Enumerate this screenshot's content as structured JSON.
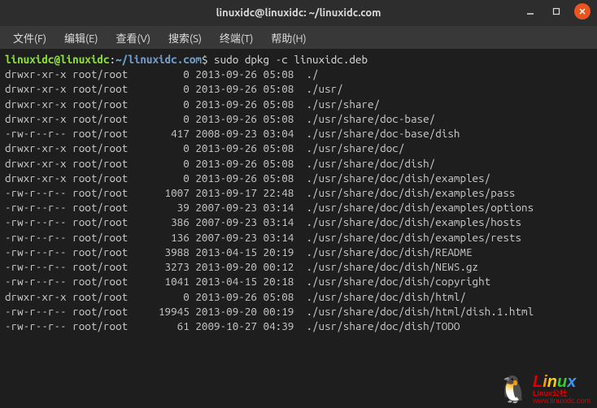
{
  "titlebar": {
    "title": "linuxidc@linuxidc: ~/linuxidc.com"
  },
  "menubar": {
    "items": [
      "文件(F)",
      "编辑(E)",
      "查看(V)",
      "搜索(S)",
      "终端(T)",
      "帮助(H)"
    ]
  },
  "prompt": {
    "user_host": "linuxidc@linuxidc",
    "colon": ":",
    "path": "~/linuxidc.com",
    "dollar": "$",
    "command": "sudo dpkg -c linuxidc.deb"
  },
  "rows": [
    {
      "perm": "drwxr-xr-x",
      "owner": "root/root",
      "size": "0",
      "date": "2013-09-26 05:08",
      "path": "./"
    },
    {
      "perm": "drwxr-xr-x",
      "owner": "root/root",
      "size": "0",
      "date": "2013-09-26 05:08",
      "path": "./usr/"
    },
    {
      "perm": "drwxr-xr-x",
      "owner": "root/root",
      "size": "0",
      "date": "2013-09-26 05:08",
      "path": "./usr/share/"
    },
    {
      "perm": "drwxr-xr-x",
      "owner": "root/root",
      "size": "0",
      "date": "2013-09-26 05:08",
      "path": "./usr/share/doc-base/"
    },
    {
      "perm": "-rw-r--r--",
      "owner": "root/root",
      "size": "417",
      "date": "2008-09-23 03:04",
      "path": "./usr/share/doc-base/dish"
    },
    {
      "perm": "drwxr-xr-x",
      "owner": "root/root",
      "size": "0",
      "date": "2013-09-26 05:08",
      "path": "./usr/share/doc/"
    },
    {
      "perm": "drwxr-xr-x",
      "owner": "root/root",
      "size": "0",
      "date": "2013-09-26 05:08",
      "path": "./usr/share/doc/dish/"
    },
    {
      "perm": "drwxr-xr-x",
      "owner": "root/root",
      "size": "0",
      "date": "2013-09-26 05:08",
      "path": "./usr/share/doc/dish/examples/"
    },
    {
      "perm": "-rw-r--r--",
      "owner": "root/root",
      "size": "1007",
      "date": "2013-09-17 22:48",
      "path": "./usr/share/doc/dish/examples/pass"
    },
    {
      "perm": "-rw-r--r--",
      "owner": "root/root",
      "size": "39",
      "date": "2007-09-23 03:14",
      "path": "./usr/share/doc/dish/examples/options"
    },
    {
      "perm": "-rw-r--r--",
      "owner": "root/root",
      "size": "386",
      "date": "2007-09-23 03:14",
      "path": "./usr/share/doc/dish/examples/hosts"
    },
    {
      "perm": "-rw-r--r--",
      "owner": "root/root",
      "size": "136",
      "date": "2007-09-23 03:14",
      "path": "./usr/share/doc/dish/examples/rests"
    },
    {
      "perm": "-rw-r--r--",
      "owner": "root/root",
      "size": "3988",
      "date": "2013-04-15 20:19",
      "path": "./usr/share/doc/dish/README"
    },
    {
      "perm": "-rw-r--r--",
      "owner": "root/root",
      "size": "3273",
      "date": "2013-09-20 00:12",
      "path": "./usr/share/doc/dish/NEWS.gz"
    },
    {
      "perm": "-rw-r--r--",
      "owner": "root/root",
      "size": "1041",
      "date": "2013-04-15 20:18",
      "path": "./usr/share/doc/dish/copyright"
    },
    {
      "perm": "drwxr-xr-x",
      "owner": "root/root",
      "size": "0",
      "date": "2013-09-26 05:08",
      "path": "./usr/share/doc/dish/html/"
    },
    {
      "perm": "-rw-r--r--",
      "owner": "root/root",
      "size": "19945",
      "date": "2013-09-20 00:19",
      "path": "./usr/share/doc/dish/html/dish.1.html"
    },
    {
      "perm": "-rw-r--r--",
      "owner": "root/root",
      "size": "61",
      "date": "2009-10-27 04:39",
      "path": "./usr/share/doc/dish/TODO"
    }
  ],
  "watermark": {
    "brand": "Linux",
    "sub": "Linux公社",
    "url": "www.linuxidc.com"
  }
}
